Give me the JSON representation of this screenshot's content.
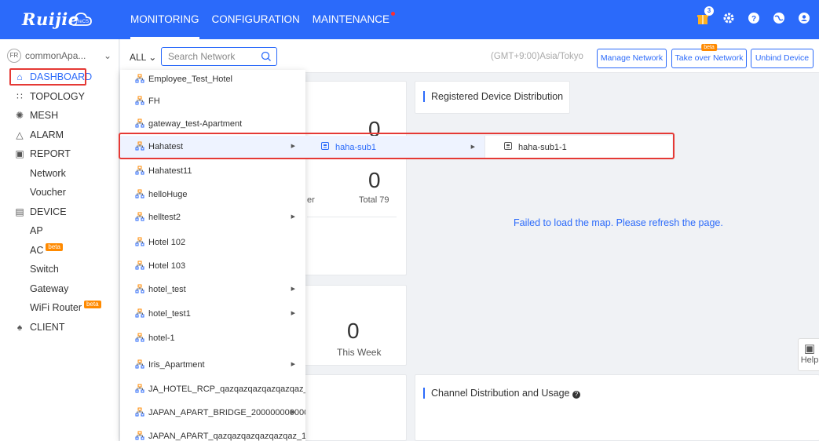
{
  "brand": {
    "logo_text": "Ruijie",
    "logo_badge": "ReCS"
  },
  "topnav": {
    "items": [
      {
        "label": "MONITORING"
      },
      {
        "label": "CONFIGURATION"
      },
      {
        "label": "MAINTENANCE"
      }
    ]
  },
  "top_icons": {
    "notification_count": "3",
    "icons": [
      "gift-icon",
      "gear-icon",
      "help-icon",
      "globe-icon",
      "user-icon"
    ]
  },
  "account": {
    "initials": "FR",
    "name": "commonApa..."
  },
  "sidebar": {
    "items": [
      {
        "label": "DASHBOARD",
        "icon": "home-icon"
      },
      {
        "label": "TOPOLOGY",
        "icon": "topology-icon"
      },
      {
        "label": "MESH",
        "icon": "mesh-icon"
      },
      {
        "label": "ALARM",
        "icon": "alarm-icon"
      },
      {
        "label": "REPORT",
        "icon": "report-icon"
      },
      {
        "label": "Network"
      },
      {
        "label": "Voucher"
      },
      {
        "label": "DEVICE",
        "icon": "device-icon"
      },
      {
        "label": "AP"
      },
      {
        "label": "AC",
        "beta": "beta"
      },
      {
        "label": "Switch"
      },
      {
        "label": "Gateway"
      },
      {
        "label": "WiFi Router",
        "beta": "beta"
      },
      {
        "label": "CLIENT",
        "icon": "client-icon"
      }
    ]
  },
  "search": {
    "scope": "ALL",
    "placeholder": "Search Network"
  },
  "header": {
    "timezone": "(GMT+9:00)Asia/Tokyo",
    "manage_btn": "Manage Network",
    "takeover_btn": "Take over Network",
    "takeover_beta": "beta",
    "unbind_btn": "Unbind Device"
  },
  "dashboard": {
    "stat1_value": "0",
    "stat2_value": "0",
    "stat2_partial_label": "er",
    "stat2_total": "Total 79",
    "stat3_value": "0",
    "stat3_label": "This Week",
    "registered_title": "Registered Device Distribution",
    "map_error": "Failed to load the map. Please refresh the page.",
    "channel_title": "Channel Distribution and Usage",
    "help_label": "Help"
  },
  "network_list": [
    {
      "name": "Employee_Test_Hotel"
    },
    {
      "name": "FH"
    },
    {
      "name": "gateway_test-Apartment"
    },
    {
      "name": "Hahatest",
      "has_children": true,
      "selected": true
    },
    {
      "name": "Hahatest11"
    },
    {
      "name": "helloHuge"
    },
    {
      "name": "helltest2",
      "has_children": true
    },
    {
      "name": "Hotel 102"
    },
    {
      "name": "Hotel 103"
    },
    {
      "name": "hotel_test",
      "has_children": true
    },
    {
      "name": "hotel_test1",
      "has_children": true
    },
    {
      "name": "hotel-1"
    },
    {
      "name": "Iris_Apartment",
      "has_children": true
    },
    {
      "name": "JA_HOTEL_RCP_qazqazqazqazqazqaz_..."
    },
    {
      "name": "JAPAN_APART_BRIDGE_200000000000...",
      "has_children": true
    },
    {
      "name": "JAPAN_APART_qazqazqazqazqazqaz_1..."
    }
  ],
  "sub_level1": {
    "name": "haha-sub1"
  },
  "sub_level2": {
    "name": "haha-sub1-1"
  },
  "colors": {
    "primary": "#2b6afa",
    "highlight_border": "#e53935",
    "beta": "#ff8a00"
  }
}
